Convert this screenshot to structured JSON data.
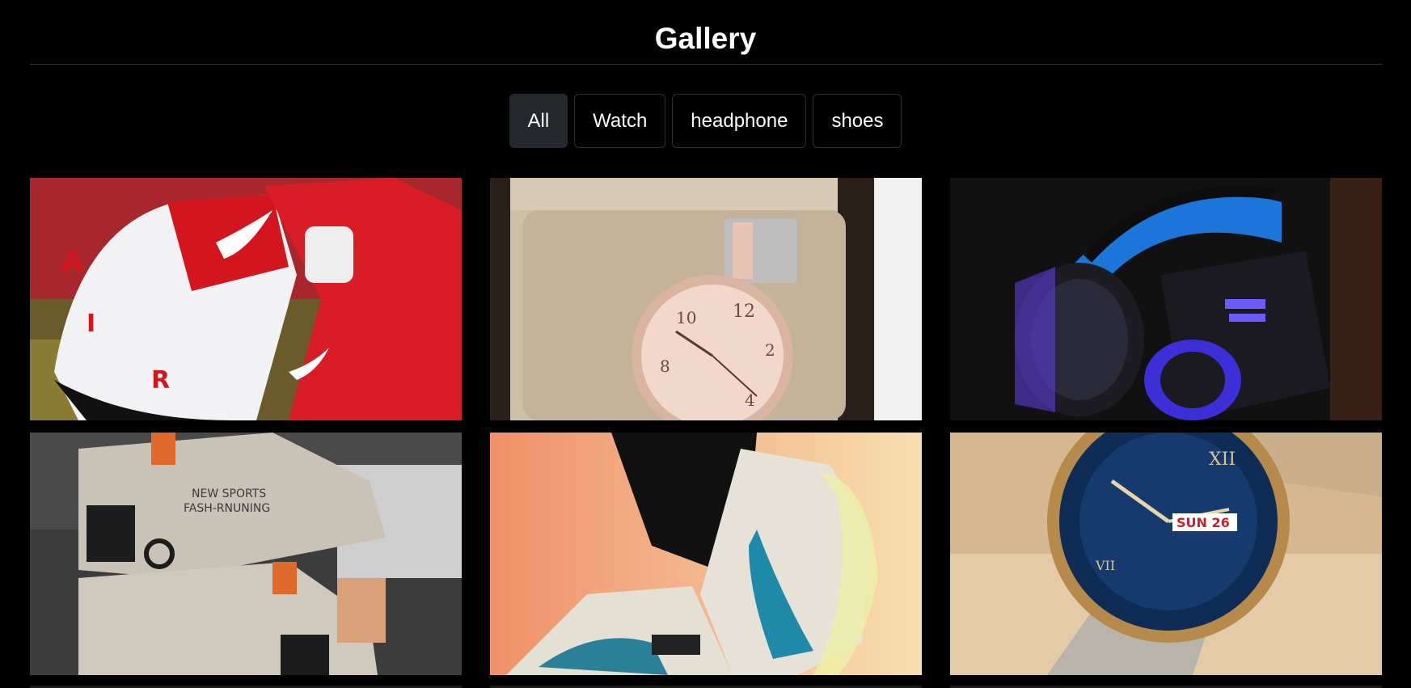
{
  "page": {
    "title": "Gallery"
  },
  "filters": [
    {
      "label": "All",
      "active": true
    },
    {
      "label": "Watch",
      "active": false
    },
    {
      "label": "headphone",
      "active": false
    },
    {
      "label": "shoes",
      "active": false
    }
  ],
  "gallery": [
    {
      "category": "shoes",
      "subject": "red-white-sneakers"
    },
    {
      "category": "Watch",
      "subject": "rose-gold-watch-in-box"
    },
    {
      "category": "headphone",
      "subject": "blue-gaming-headset"
    },
    {
      "category": "shoes",
      "subject": "grey-orange-sneakers"
    },
    {
      "category": "shoes",
      "subject": "white-blue-running-shoe"
    },
    {
      "category": "Watch",
      "subject": "blue-dial-gold-watch"
    }
  ],
  "colors": {
    "background": "#000000",
    "active_filter": "#25282c",
    "filter_border": "#2f2f2f"
  }
}
